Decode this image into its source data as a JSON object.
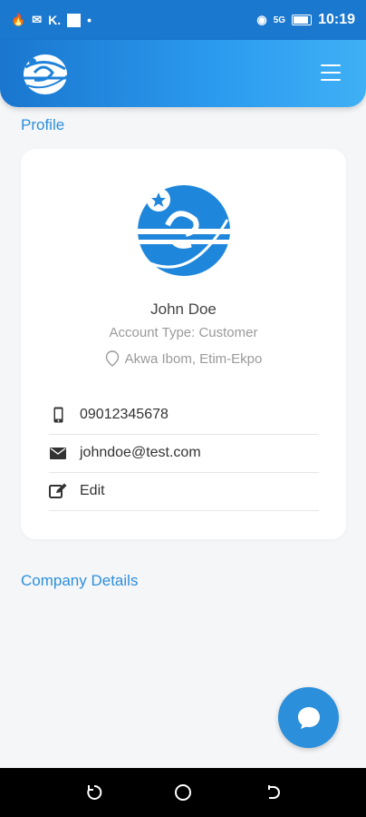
{
  "status_bar": {
    "left_text": "K.",
    "dot": "•",
    "time": "10:19",
    "signal_text": "5G"
  },
  "header": {
    "logo_icon": "app-logo",
    "menu_icon": "hamburger-icon"
  },
  "profile": {
    "section_title": "Profile",
    "name": "John Doe",
    "account_type": "Account Type: Customer",
    "location": "Akwa Ibom, Etim-Ekpo",
    "phone": "09012345678",
    "email": "johndoe@test.com",
    "edit_label": "Edit"
  },
  "company": {
    "section_title": "Company Details"
  },
  "colors": {
    "accent": "#2b8fdb",
    "header_start": "#1a76cf",
    "header_end": "#3fb0f5"
  }
}
